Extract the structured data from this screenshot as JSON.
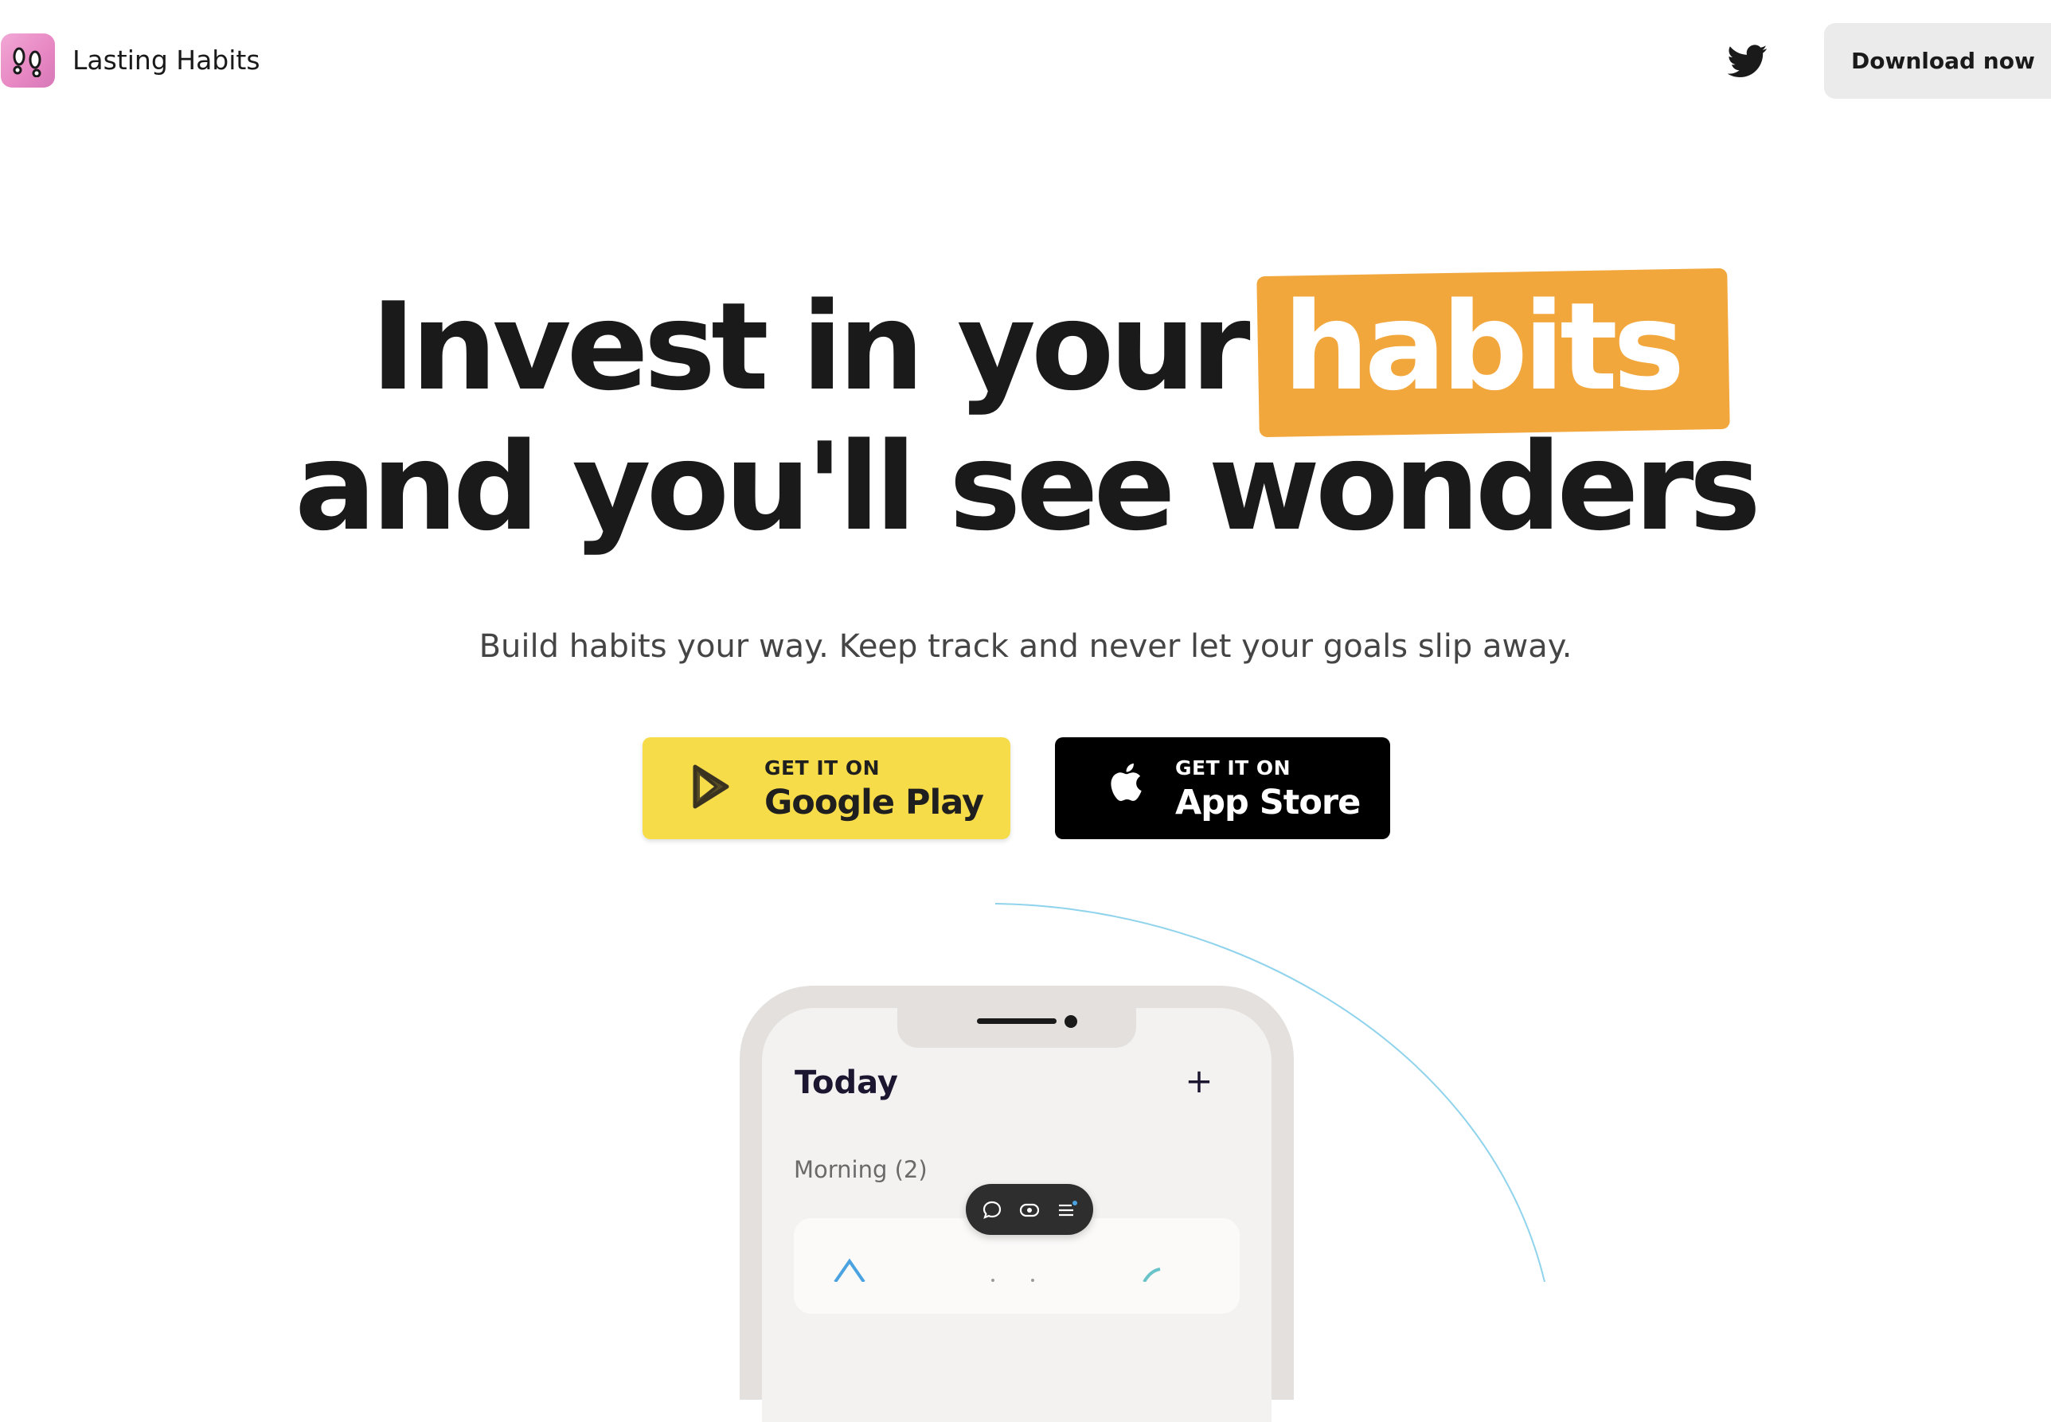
{
  "header": {
    "brand_name": "Lasting Habits",
    "logo_icon": "footprints-icon",
    "twitter_icon": "twitter-bird-icon",
    "download_label": "Download now"
  },
  "hero": {
    "line1_prefix": "Invest in your",
    "line1_highlight": "habits",
    "line2": "and you'll see wonders",
    "highlight_color": "#f2a73d",
    "subtitle": "Build habits your way. Keep track and never let your goals slip away."
  },
  "stores": {
    "google": {
      "small": "GET IT ON",
      "big": "Google Play",
      "icon": "play-store-icon",
      "color": "#f7dc4a"
    },
    "apple": {
      "small": "GET IT ON",
      "big": "App Store",
      "icon": "apple-icon",
      "color": "#000000"
    }
  },
  "phone": {
    "title": "Today",
    "add_symbol": "+",
    "section_label": "Morning (2)",
    "toolbar_icons": [
      "chat-bubble-icon",
      "eye-icon",
      "list-icon"
    ]
  }
}
